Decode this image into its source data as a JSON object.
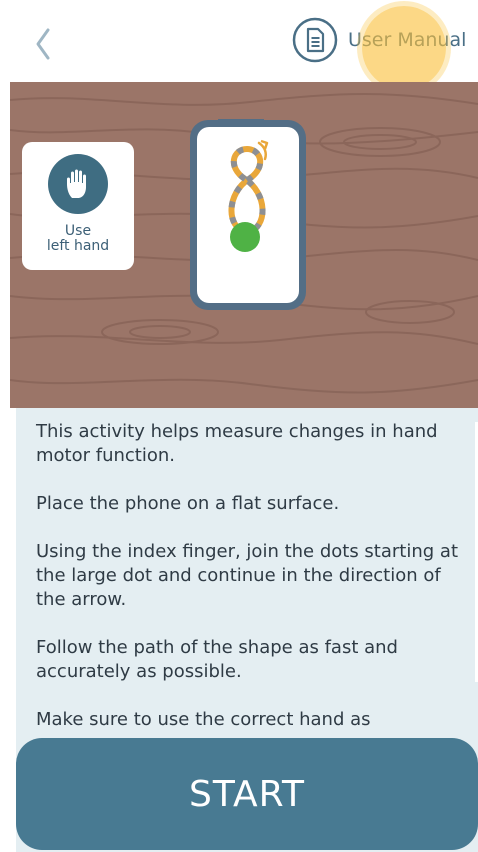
{
  "header": {
    "back_icon": "chevron-left-icon",
    "manual_icon": "document-icon",
    "manual_label": "User Manual"
  },
  "illustration": {
    "hand_card": {
      "icon": "raised-hand-icon",
      "label_line1": "Use",
      "label_line2": "left hand"
    },
    "phone": {
      "shape": "figure-eight-path",
      "start_dot_color": "#4fb245"
    }
  },
  "instructions": [
    "This activity helps measure changes in hand motor function.",
    "Place the phone on a flat surface.",
    "Using the index finger, join the dots starting at the large dot and continue in the direction of the arrow.",
    "Follow the path of the shape as fast and accurately as possible.",
    "Make sure to use the correct hand as"
  ],
  "start_button": {
    "label": "START"
  },
  "colors": {
    "accent": "#487a92",
    "wood": "#9b7568",
    "content_bg": "#e4eef2",
    "touch_indicator": "#fac03c"
  }
}
